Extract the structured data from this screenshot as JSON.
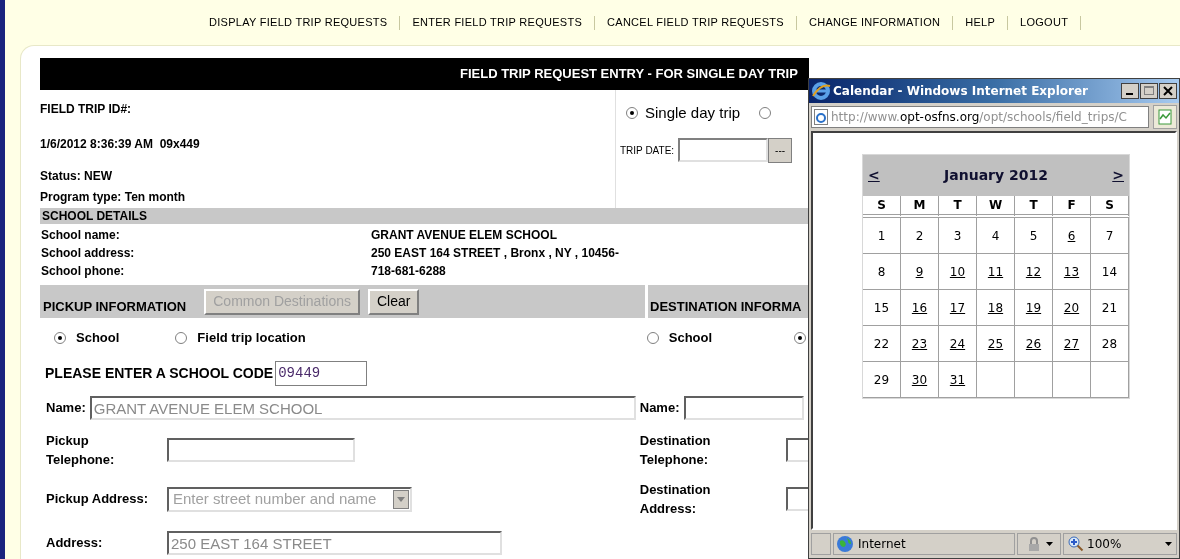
{
  "nav": [
    {
      "label": "DISPLAY FIELD TRIP REQUESTS"
    },
    {
      "label": "ENTER FIELD TRIP REQUESTS"
    },
    {
      "label": "CANCEL FIELD TRIP REQUESTS"
    },
    {
      "label": "CHANGE INFORMATION"
    },
    {
      "label": "HELP"
    },
    {
      "label": "LOGOUT"
    }
  ],
  "form": {
    "title": "FIELD TRIP REQUEST ENTRY - FOR SINGLE DAY TRIP",
    "id_label": "FIELD TRIP ID#:",
    "timestamp": "1/6/2012 8:36:39 AM  09x449",
    "status": "Status: NEW",
    "program_type": "Program type: Ten month",
    "trip_types": [
      {
        "label": "Single day trip",
        "selected": true
      },
      {
        "selected": false
      }
    ],
    "trip_date": {
      "label": "TRIP DATE:",
      "picker_button": "---"
    },
    "school_details": {
      "heading": "SCHOOL DETAILS",
      "rows": [
        {
          "label": "School name:",
          "value": "GRANT AVENUE ELEM SCHOOL"
        },
        {
          "label": "School address:",
          "value": "250 EAST 164 STREET , Bronx , NY , 10456-"
        },
        {
          "label": "School phone:",
          "value": "718-681-6288"
        }
      ]
    },
    "pickup": {
      "heading": "PICKUP INFORMATION",
      "buttons": [
        {
          "label": "Common Destinations",
          "disabled": true
        },
        {
          "label": "Clear",
          "disabled": false
        }
      ],
      "location_types": [
        {
          "label": "School",
          "selected": true
        },
        {
          "label": "Field trip location",
          "selected": false
        }
      ],
      "school_code_label": "PLEASE ENTER A SCHOOL CODE",
      "school_code": "09449",
      "name_label": "Name:",
      "name": "GRANT AVENUE ELEM SCHOOL",
      "telephone_label": "Pickup\nTelephone:",
      "address_select_label": "Pickup Address:",
      "address_select_placeholder": "Enter street number and name",
      "address_label": "Address:",
      "address": "250 EAST 164 STREET"
    },
    "destination": {
      "heading": "DESTINATION INFORMA",
      "location_types": [
        {
          "label": "School",
          "selected": false
        },
        {
          "selected": true
        }
      ],
      "name_label": "Name:",
      "telephone_label": "Destination\nTelephone:",
      "address_label": "Destination\nAddress:"
    }
  },
  "calendar_window": {
    "title": "Calendar - Windows Internet Explorer",
    "address": {
      "prefix": "http://www.",
      "domain": "opt-osfns.org",
      "path": "/opt/schools/field_trips/C"
    },
    "prev": "<",
    "month": "January 2012",
    "next": ">",
    "weekdays": [
      "S",
      "M",
      "T",
      "W",
      "T",
      "F",
      "S"
    ],
    "weeks": [
      [
        {
          "day": "1",
          "link": false
        },
        {
          "day": "2",
          "link": false
        },
        {
          "day": "3",
          "link": false
        },
        {
          "day": "4",
          "link": false
        },
        {
          "day": "5",
          "link": false
        },
        {
          "day": "6",
          "link": true
        },
        {
          "day": "7",
          "link": false
        }
      ],
      [
        {
          "day": "8",
          "link": false
        },
        {
          "day": "9",
          "link": true
        },
        {
          "day": "10",
          "link": true
        },
        {
          "day": "11",
          "link": true
        },
        {
          "day": "12",
          "link": true
        },
        {
          "day": "13",
          "link": true
        },
        {
          "day": "14",
          "link": false
        }
      ],
      [
        {
          "day": "15",
          "link": false
        },
        {
          "day": "16",
          "link": true
        },
        {
          "day": "17",
          "link": true
        },
        {
          "day": "18",
          "link": true
        },
        {
          "day": "19",
          "link": true
        },
        {
          "day": "20",
          "link": true
        },
        {
          "day": "21",
          "link": false
        }
      ],
      [
        {
          "day": "22",
          "link": false
        },
        {
          "day": "23",
          "link": true
        },
        {
          "day": "24",
          "link": true
        },
        {
          "day": "25",
          "link": true
        },
        {
          "day": "26",
          "link": true
        },
        {
          "day": "27",
          "link": true
        },
        {
          "day": "28",
          "link": false
        }
      ],
      [
        {
          "day": "29",
          "link": false
        },
        {
          "day": "30",
          "link": true
        },
        {
          "day": "31",
          "link": true
        }
      ]
    ],
    "status_zone": "Internet",
    "zoom": "100%"
  }
}
